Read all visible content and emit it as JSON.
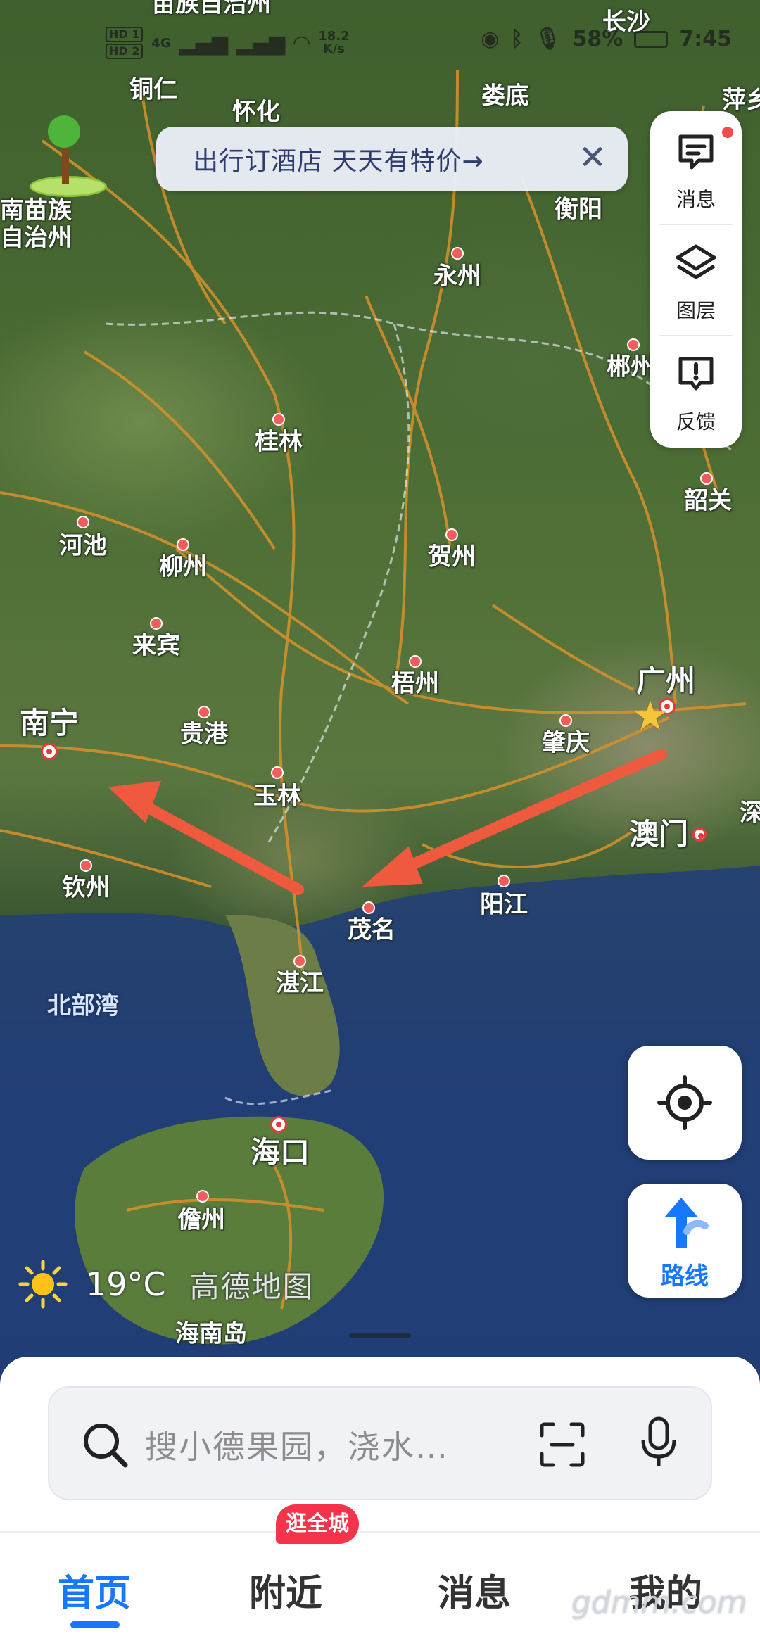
{
  "status_bar": {
    "network_left": [
      "HD 1",
      "HD 2"
    ],
    "signal": "4G",
    "speed": "18.2",
    "speed_unit": "K/s",
    "battery": "58%",
    "time": "7:45"
  },
  "banner": {
    "text": "出行订酒店 天天有特价→",
    "close": "✕"
  },
  "tools": {
    "messages": "消息",
    "layers": "图层",
    "feedback": "反馈"
  },
  "route_button": {
    "label": "路线"
  },
  "weather": {
    "temp": "19°C",
    "app_logo": "高德地图"
  },
  "search": {
    "placeholder": "搜小德果园，浇水…"
  },
  "tabs": {
    "home": "首页",
    "nearby": "附近",
    "nearby_badge": "逛全城",
    "messages": "消息",
    "mine": "我的"
  },
  "watermark": "gdmm.com",
  "map_labels": {
    "changsha": "长沙",
    "loudi": "娄底",
    "pingxiang": "萍乡",
    "tongren": "铜仁",
    "huaihua": "怀化",
    "autonomous_top": "苗族自治州",
    "qiandongnan_1": "南苗族",
    "qiandongnan_2": "自治州",
    "hengyang": "衡阳",
    "yongzhou": "永州",
    "chenzhou": "郴州",
    "guilin": "桂林",
    "shaoguan": "韶关",
    "hechi": "河池",
    "liuzhou": "柳州",
    "hezhou": "贺州",
    "laibin": "来宾",
    "wuzhou": "梧州",
    "guangzhou": "广州",
    "nanning": "南宁",
    "guigang": "贵港",
    "zhaoqing": "肇庆",
    "yulin": "玉林",
    "macau": "澳门",
    "shenzhen": "深",
    "qinzhou": "钦州",
    "maoming": "茂名",
    "yangjiang": "阳江",
    "zhanjiang": "湛江",
    "beibu_gulf": "北部湾",
    "haikou": "海口",
    "danzhou": "儋州",
    "hainan_island": "海南岛"
  }
}
